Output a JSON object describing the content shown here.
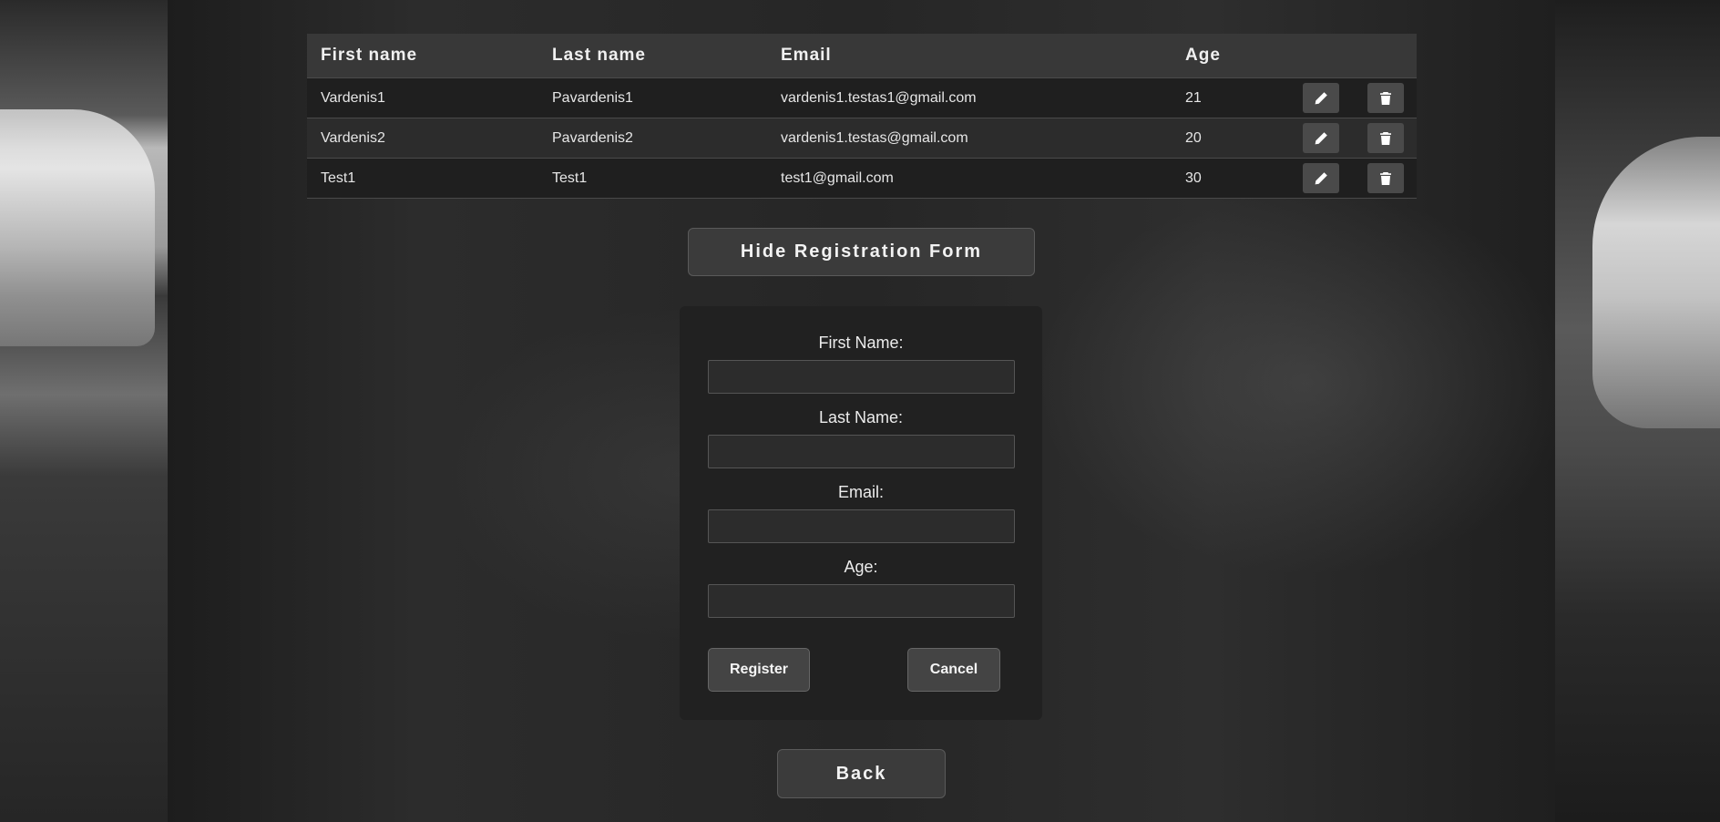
{
  "table": {
    "headers": [
      "First name",
      "Last name",
      "Email",
      "Age"
    ],
    "rows": [
      {
        "first": "Vardenis1",
        "last": "Pavardenis1",
        "email": "vardenis1.testas1@gmail.com",
        "age": "21"
      },
      {
        "first": "Vardenis2",
        "last": "Pavardenis2",
        "email": "vardenis1.testas@gmail.com",
        "age": "20"
      },
      {
        "first": "Test1",
        "last": "Test1",
        "email": "test1@gmail.com",
        "age": "30"
      }
    ],
    "row_actions": [
      "edit-icon",
      "trash-icon"
    ]
  },
  "toggle_form_label": "Hide Registration Form",
  "form": {
    "first_name_label": "First Name:",
    "first_name_value": "",
    "last_name_label": "Last Name:",
    "last_name_value": "",
    "email_label": "Email:",
    "email_value": "",
    "age_label": "Age:",
    "age_value": "",
    "register_label": "Register",
    "cancel_label": "Cancel"
  },
  "back_label": "Back",
  "colors": {
    "button_bg": "#3b3b3b",
    "icon_button_bg": "#4a4a4a",
    "text": "#e8e8e8"
  }
}
